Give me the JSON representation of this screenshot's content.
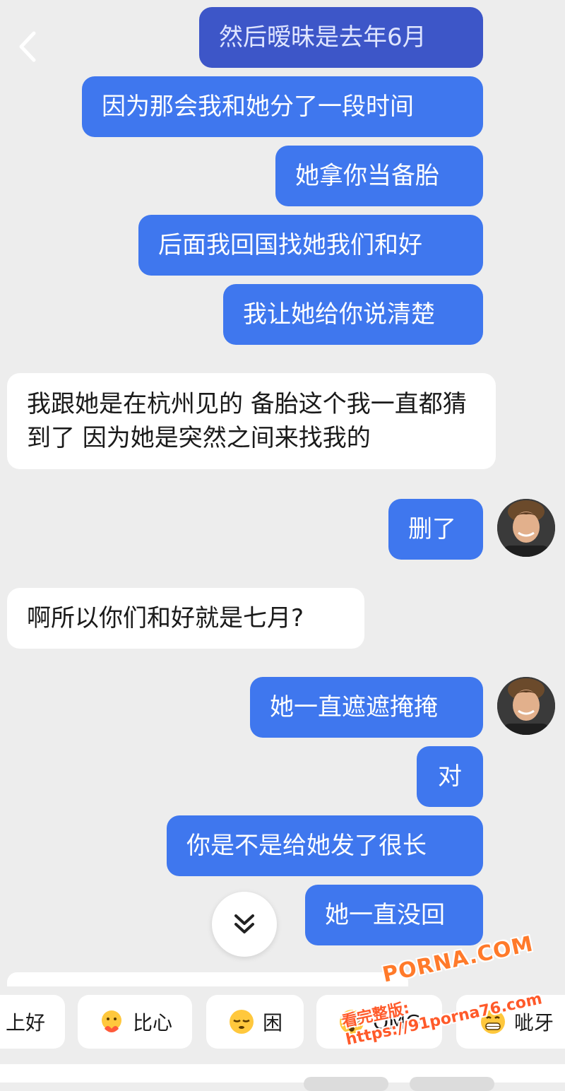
{
  "messages": [
    {
      "side": "out",
      "text": "然后暧昧是去年6月"
    },
    {
      "side": "out",
      "text": "因为那会我和她分了一段时间"
    },
    {
      "side": "out",
      "text": "她拿你当备胎"
    },
    {
      "side": "out",
      "text": "后面我回国找她我们和好"
    },
    {
      "side": "out",
      "text": "我让她给你说清楚"
    },
    {
      "side": "in",
      "text": "我跟她是在杭州见的 备胎这个我一直都猜到了 因为她是突然之间来找我的"
    },
    {
      "side": "out",
      "text": "删了"
    },
    {
      "side": "in",
      "text": "啊所以你们和好就是七月?"
    },
    {
      "side": "out",
      "text": "她一直遮遮掩掩"
    },
    {
      "side": "out",
      "text": "对"
    },
    {
      "side": "out",
      "text": "你是不是给她发了很长"
    },
    {
      "side": "out",
      "text": "她一直没回"
    }
  ],
  "quick_replies": [
    {
      "label": "上好",
      "icon": "none"
    },
    {
      "label": "比心",
      "icon": "heart-hands-emoji-icon"
    },
    {
      "label": "困",
      "icon": "sleepy-emoji-icon"
    },
    {
      "label": "OMG",
      "icon": "omg-emoji-icon"
    },
    {
      "label": "呲牙",
      "icon": "grin-emoji-icon"
    }
  ],
  "watermark": {
    "line1": "PORNA.COM",
    "line2": "看完整版: https://91porna76.com"
  },
  "colors": {
    "background": "#ededed",
    "outgoing_bubble": "#3f77ee",
    "incoming_bubble": "#ffffff"
  }
}
